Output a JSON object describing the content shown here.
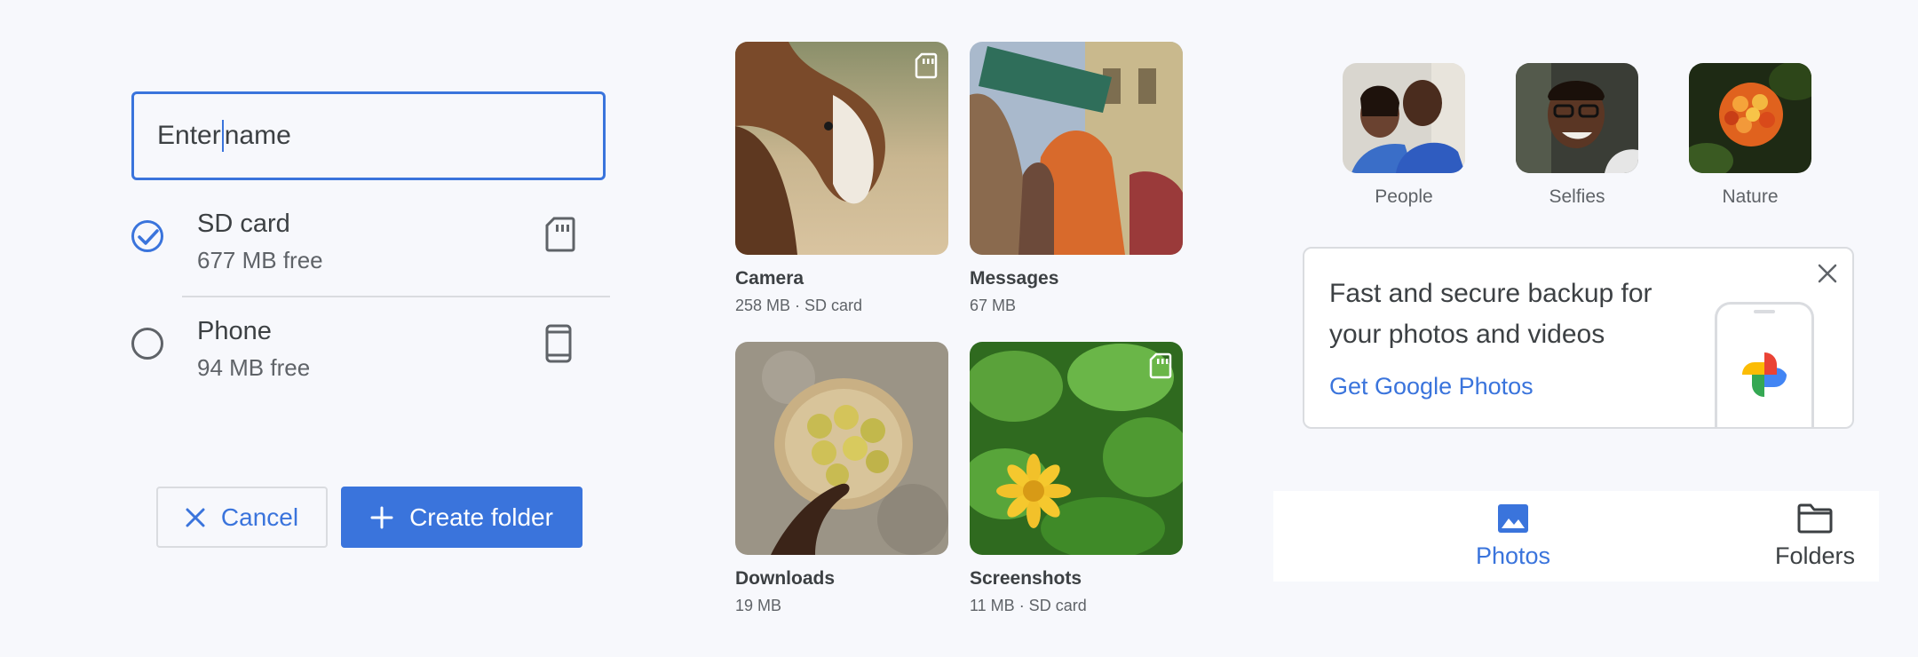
{
  "dialog": {
    "name_input": {
      "value_before_cursor": "Enter",
      "value_after_cursor": "name"
    },
    "storage_options": [
      {
        "title": "SD card",
        "subtitle": "677 MB free",
        "selected": true,
        "icon": "sd-card-icon"
      },
      {
        "title": "Phone",
        "subtitle": "94 MB free",
        "selected": false,
        "icon": "phone-icon"
      }
    ],
    "cancel_label": "Cancel",
    "create_label": "Create folder"
  },
  "folders": [
    {
      "name": "Camera",
      "meta": "258 MB · SD card",
      "sd_badge": true
    },
    {
      "name": "Messages",
      "meta": "67 MB",
      "sd_badge": false
    },
    {
      "name": "Downloads",
      "meta": "19 MB",
      "sd_badge": false
    },
    {
      "name": "Screenshots",
      "meta": "11 MB · SD card",
      "sd_badge": true
    }
  ],
  "categories": [
    {
      "label": "People"
    },
    {
      "label": "Selfies"
    },
    {
      "label": "Nature"
    }
  ],
  "promo": {
    "headline": "Fast and secure backup for your photos and videos",
    "link": "Get Google Photos"
  },
  "bottom_nav": {
    "photos_label": "Photos",
    "folders_label": "Folders",
    "active": "Photos"
  },
  "colors": {
    "accent": "#3a74dc",
    "background": "#f7f8fc",
    "text": "#3c4043",
    "secondary_text": "#5f6368"
  }
}
